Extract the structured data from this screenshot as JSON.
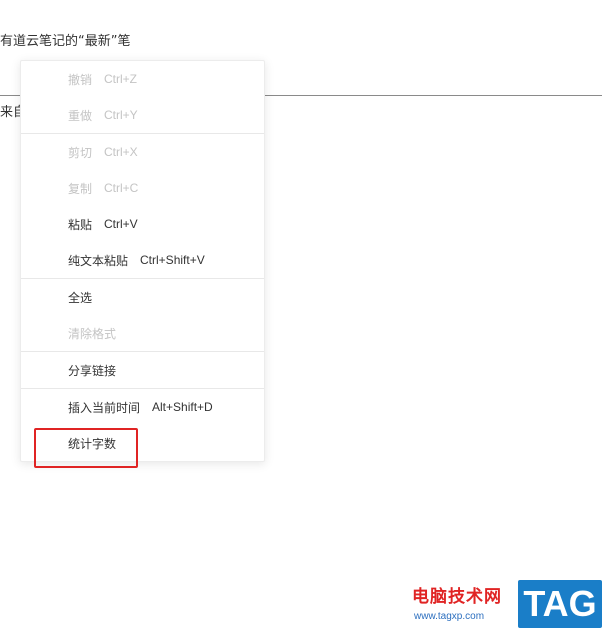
{
  "document": {
    "title_text": "有道云笔记的“最新”笔",
    "body_text": "来自"
  },
  "context_menu": {
    "groups": [
      {
        "items": [
          {
            "label": "撤销",
            "shortcut": "Ctrl+Z",
            "enabled": false
          },
          {
            "label": "重做",
            "shortcut": "Ctrl+Y",
            "enabled": false
          }
        ]
      },
      {
        "items": [
          {
            "label": "剪切",
            "shortcut": "Ctrl+X",
            "enabled": false
          },
          {
            "label": "复制",
            "shortcut": "Ctrl+C",
            "enabled": false
          },
          {
            "label": "粘贴",
            "shortcut": "Ctrl+V",
            "enabled": true
          },
          {
            "label": "纯文本粘贴",
            "shortcut": "Ctrl+Shift+V",
            "enabled": true
          }
        ]
      },
      {
        "items": [
          {
            "label": "全选",
            "shortcut": "",
            "enabled": true
          },
          {
            "label": "清除格式",
            "shortcut": "",
            "enabled": false
          }
        ]
      },
      {
        "items": [
          {
            "label": "分享链接",
            "shortcut": "",
            "enabled": true
          }
        ]
      },
      {
        "items": [
          {
            "label": "插入当前时间",
            "shortcut": "Alt+Shift+D",
            "enabled": true
          },
          {
            "label": "统计字数",
            "shortcut": "",
            "enabled": true
          }
        ]
      }
    ]
  },
  "highlight": {
    "target_label": "统计字数",
    "color": "#e02424"
  },
  "watermark": {
    "site_name": "电脑技术网",
    "url": "www.tagxp.com",
    "tag": "TAG",
    "colors": {
      "text": "#e02424",
      "tag_bg": "#1a7ec8"
    }
  },
  "colors": {
    "enabled_text": "#333333",
    "disabled_text": "#c4c4c4",
    "divider": "#8a8a8a"
  }
}
